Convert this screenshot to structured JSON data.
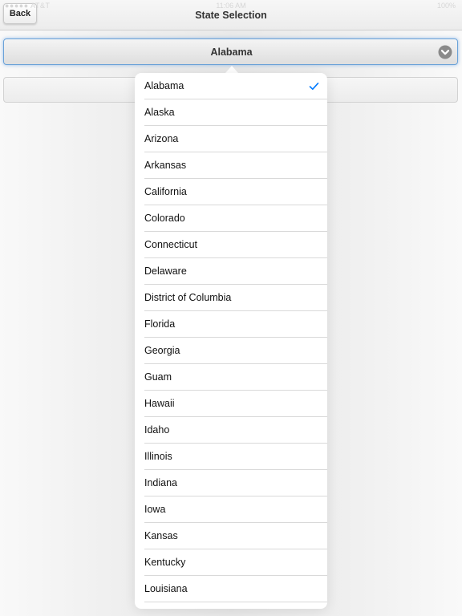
{
  "status_bar": {
    "carrier": "●●●●● AT&T",
    "time": "11:06 AM",
    "battery": "100%"
  },
  "header": {
    "back_label": "Back",
    "title": "State Selection"
  },
  "select": {
    "value": "Alabama",
    "icon": "chevron-down-icon"
  },
  "list": {
    "selected": "Alabama",
    "items": [
      "Alabama",
      "Alaska",
      "Arizona",
      "Arkansas",
      "California",
      "Colorado",
      "Connecticut",
      "Delaware",
      "District of Columbia",
      "Florida",
      "Georgia",
      "Guam",
      "Hawaii",
      "Idaho",
      "Illinois",
      "Indiana",
      "Iowa",
      "Kansas",
      "Kentucky",
      "Louisiana"
    ]
  },
  "colors": {
    "accent": "#007aff",
    "focus_border": "#6aa2d8"
  }
}
